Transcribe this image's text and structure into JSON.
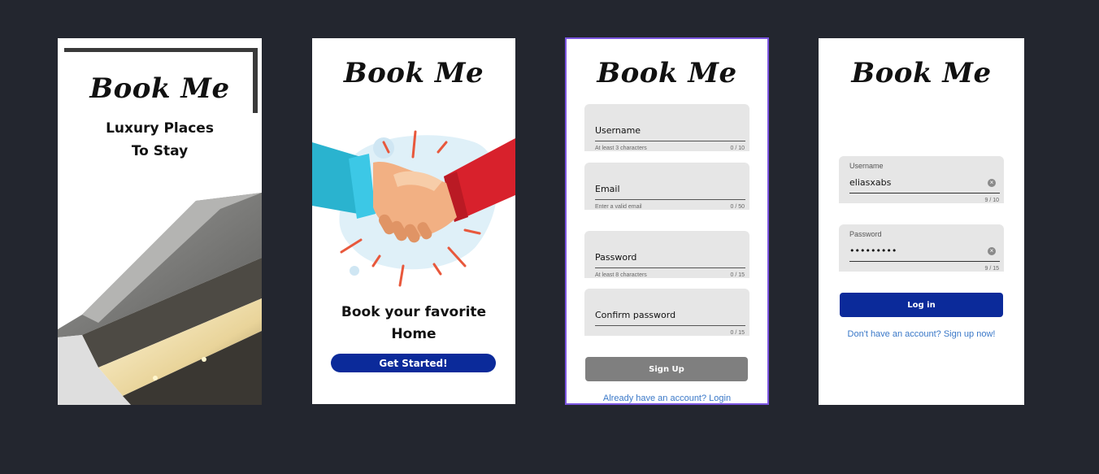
{
  "app": {
    "brand": "Book Me"
  },
  "splash": {
    "tagline_line1": "Luxury Places",
    "tagline_line2": "To Stay"
  },
  "onboarding": {
    "headline_line1": "Book your favorite",
    "headline_line2": "Home",
    "cta_label": "Get Started!"
  },
  "signup": {
    "fields": [
      {
        "label": "Username",
        "hint": "At least 3 characters",
        "counter": "0 / 10"
      },
      {
        "label": "Email",
        "hint": "Enter a valid email",
        "counter": "0 / 50"
      },
      {
        "label": "Password",
        "hint": "At least 8 characters",
        "counter": "0 / 15"
      },
      {
        "label": "Confirm password",
        "hint": "",
        "counter": "0 / 15"
      }
    ],
    "submit_label": "Sign Up",
    "login_link": "Already have an account? Login"
  },
  "login": {
    "username_label": "Username",
    "username_value": "eliasxabs",
    "username_counter": "9 / 10",
    "password_label": "Password",
    "password_value": "•••••••••",
    "password_counter": "9 / 15",
    "submit_label": "Log in",
    "signup_link": "Don't have an account? Sign up now!"
  },
  "colors": {
    "background": "#23262f",
    "primary_button": "#0b2a9a",
    "disabled_button": "#7f7f7f",
    "link": "#3a78c8",
    "selection_border": "#7b55e0"
  }
}
